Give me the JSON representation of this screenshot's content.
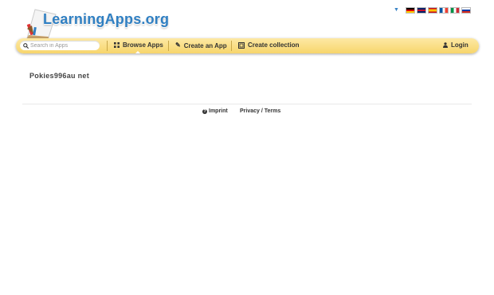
{
  "brand": {
    "name": "LearningApps.org"
  },
  "languages": {
    "flags": [
      {
        "name": "german-flag",
        "colors": [
          "#000000",
          "#dd0000",
          "#ffce00"
        ]
      },
      {
        "name": "uk-flag",
        "colors": [
          "#012169",
          "#ffffff",
          "#c8102e"
        ]
      },
      {
        "name": "spanish-flag",
        "colors": [
          "#c60b1e",
          "#ffc400",
          "#c60b1e"
        ]
      },
      {
        "name": "french-flag",
        "colors": [
          "#0055a4",
          "#ffffff",
          "#ef4135"
        ]
      },
      {
        "name": "italian-flag",
        "colors": [
          "#009246",
          "#ffffff",
          "#ce2b37"
        ]
      },
      {
        "name": "russian-flag",
        "colors": [
          "#ffffff",
          "#0039a6",
          "#d52b1e"
        ]
      }
    ]
  },
  "nav": {
    "search_placeholder": "Search in Apps",
    "browse_apps": "Browse Apps",
    "create_app": "Create an App",
    "create_collection": "Create collection",
    "login": "Login"
  },
  "main": {
    "title": "Pokies996au net"
  },
  "footer": {
    "imprint": "Imprint",
    "privacy_terms": "Privacy / Terms"
  },
  "colors": {
    "navbar": "#f7d56b",
    "brand_blue": "#2f7fc2"
  }
}
